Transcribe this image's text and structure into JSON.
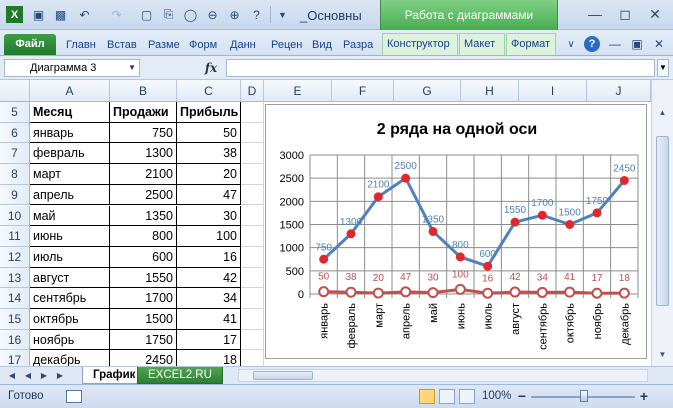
{
  "window": {
    "title": "_Основны",
    "context_tab_title": "Работа с диаграммами"
  },
  "ribbon": {
    "file_tab": "Файл",
    "tabs": [
      "Главн",
      "Встав",
      "Разме",
      "Форм",
      "Данн",
      "Рецен",
      "Вид",
      "Разра"
    ],
    "context_tabs": [
      "Конструктор",
      "Макет",
      "Формат"
    ]
  },
  "formula_bar": {
    "name_box": "Диаграмма 3",
    "fx_label": "fx",
    "formula": ""
  },
  "columns": [
    "A",
    "B",
    "C",
    "D",
    "E",
    "F",
    "G",
    "H",
    "I",
    "J"
  ],
  "table": {
    "headers": {
      "row": "5",
      "a": "Месяц",
      "b": "Продажи",
      "c": "Прибыль"
    },
    "rows": [
      {
        "row": "6",
        "month": "январь",
        "sales": "750",
        "profit": "50"
      },
      {
        "row": "7",
        "month": "февраль",
        "sales": "1300",
        "profit": "38"
      },
      {
        "row": "8",
        "month": "март",
        "sales": "2100",
        "profit": "20"
      },
      {
        "row": "9",
        "month": "апрель",
        "sales": "2500",
        "profit": "47"
      },
      {
        "row": "10",
        "month": "май",
        "sales": "1350",
        "profit": "30"
      },
      {
        "row": "11",
        "month": "июнь",
        "sales": "800",
        "profit": "100"
      },
      {
        "row": "12",
        "month": "июль",
        "sales": "600",
        "profit": "16"
      },
      {
        "row": "13",
        "month": "август",
        "sales": "1550",
        "profit": "42"
      },
      {
        "row": "14",
        "month": "сентябрь",
        "sales": "1700",
        "profit": "34"
      },
      {
        "row": "15",
        "month": "октябрь",
        "sales": "1500",
        "profit": "41"
      },
      {
        "row": "16",
        "month": "ноябрь",
        "sales": "1750",
        "profit": "17"
      },
      {
        "row": "17",
        "month": "декабрь",
        "sales": "2450",
        "profit": "18"
      }
    ]
  },
  "chart_data": {
    "type": "line",
    "title": "2 ряда на одной оси",
    "categories": [
      "январь",
      "февраль",
      "март",
      "апрель",
      "май",
      "июнь",
      "июль",
      "август",
      "сентябрь",
      "октябрь",
      "ноябрь",
      "декабрь"
    ],
    "series": [
      {
        "values": [
          750,
          1300,
          2100,
          2500,
          1350,
          800,
          600,
          1550,
          1700,
          1500,
          1750,
          2450
        ],
        "color": "#4f81bd",
        "marker_color": "#e0282c",
        "label_color": "#4f81bd"
      },
      {
        "values": [
          50,
          38,
          20,
          47,
          30,
          100,
          16,
          42,
          34,
          41,
          17,
          18
        ],
        "color": "#c0504d",
        "marker_color": "#ffffff",
        "label_color": "#c0504d"
      }
    ],
    "y_ticks": [
      "0",
      "500",
      "1000",
      "1500",
      "2000",
      "2500",
      "3000"
    ],
    "ylim": [
      0,
      3000
    ],
    "grid": true,
    "legend": "none"
  },
  "sheets": {
    "active": "График",
    "other": "EXCEL2.RU"
  },
  "status": {
    "ready": "Готово",
    "zoom": "100%",
    "zoom_percent": 100
  },
  "colors": {
    "accent_green": "#48ad52",
    "ribbon_text": "#15428b"
  }
}
